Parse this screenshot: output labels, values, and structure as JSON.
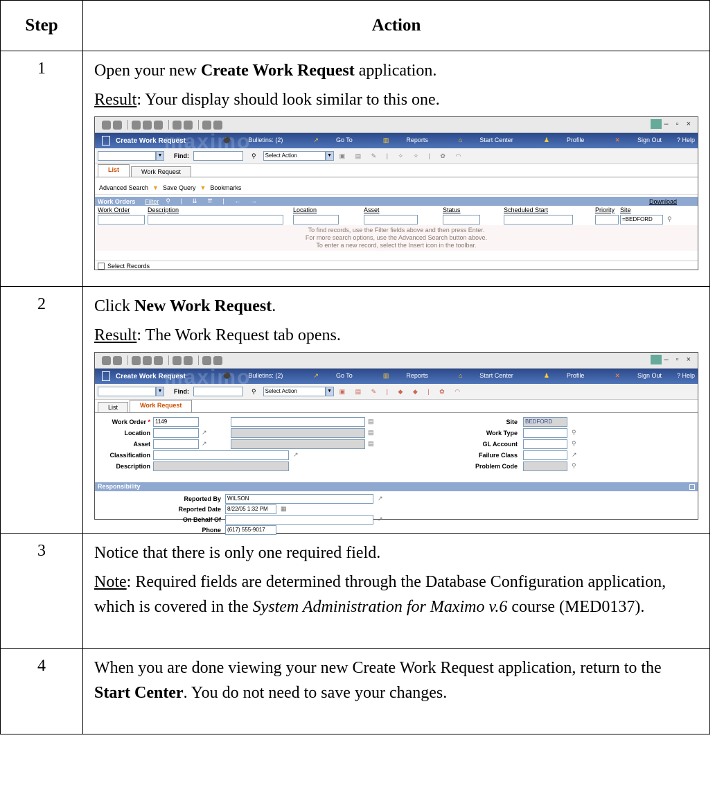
{
  "table": {
    "header_step": "Step",
    "header_action": "Action",
    "rows": [
      {
        "step": "1"
      },
      {
        "step": "2"
      },
      {
        "step": "3"
      },
      {
        "step": "4"
      }
    ]
  },
  "step1": {
    "l1_a": "Open your new ",
    "l1_b": "Create Work Request",
    "l1_c": " application.",
    "result_label": "Result",
    "result_text": ": Your display should look similar to this one."
  },
  "step2": {
    "l1_a": "Click ",
    "l1_b": "New Work Request",
    "l1_c": ".",
    "result_label": "Result",
    "result_text": ": The Work Request tab opens."
  },
  "step3": {
    "l1": "Notice that there is only one required field.",
    "note_label": "Note",
    "note_a": ": Required fields are determined through the Database Configuration application, which is covered in the ",
    "note_italic": "System Administration for Maximo v.6",
    "note_b": " course (MED0137)."
  },
  "step4": {
    "a": "When you are done viewing your new Create Work Request application, return to the ",
    "b": "Start Center",
    "c": ". You do not need to save your changes."
  },
  "maximo": {
    "app_title": "Create Work Request",
    "brand": "maximo",
    "bulletins": "Bulletins: (2)",
    "goto": "Go To",
    "reports": "Reports",
    "start_center": "Start Center",
    "profile": "Profile",
    "sign_out": "Sign Out",
    "help": "? Help",
    "find_label": "Find:",
    "select_action": "Select Action",
    "tab_list": "List",
    "tab_work_request": "Work Request",
    "advanced_search": "Advanced Search",
    "save_query": "Save Query",
    "bookmarks": "Bookmarks",
    "list_title": "Work Orders",
    "filter": "Filter",
    "download": "Download",
    "columns": [
      "Work Order",
      "Description",
      "Location",
      "Asset",
      "Status",
      "Scheduled Start",
      "Priority",
      "Site"
    ],
    "site_filter": "=BEDFORD",
    "msg1": "To find records, use the Filter fields above and then press Enter.",
    "msg2": "For more search options, use the Advanced Search button above.",
    "msg3": "To enter a new record, select the Insert icon in the toolbar.",
    "select_records": "Select Records",
    "form": {
      "work_order_label": "Work Order",
      "work_order_value": "1149",
      "location_label": "Location",
      "asset_label": "Asset",
      "classification_label": "Classification",
      "description_label": "Description",
      "site_label": "Site",
      "site_value": "BEDFORD",
      "work_type_label": "Work Type",
      "gl_account_label": "GL Account",
      "failure_class_label": "Failure Class",
      "problem_code_label": "Problem Code",
      "responsibility": "Responsibility",
      "reported_by_label": "Reported By",
      "reported_by_value": "WILSON",
      "reported_date_label": "Reported Date",
      "reported_date_value": "8/22/05 1:32 PM",
      "on_behalf_label": "On Behalf Of",
      "phone_label": "Phone",
      "phone_value": "(617) 555-9017"
    }
  }
}
